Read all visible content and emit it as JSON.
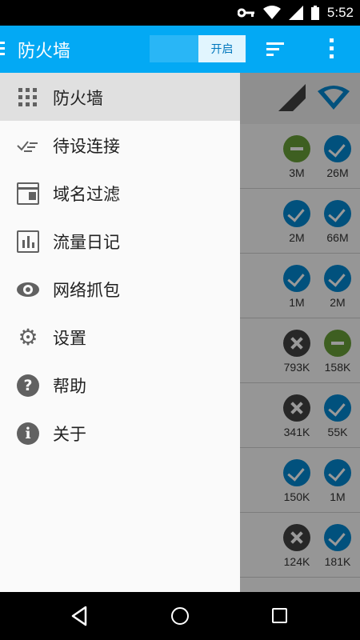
{
  "status_bar": {
    "time": "5:52",
    "icons": [
      "key-icon",
      "wifi-icon",
      "signal-icon",
      "battery-icon"
    ]
  },
  "app_bar": {
    "title": "防火墙",
    "switch_label": "开启",
    "icons": [
      "menu-icon",
      "sort-icon",
      "more-vert-icon"
    ],
    "colors": {
      "primary": "#03a9f4",
      "switch_thumb": "#e1f5fe"
    }
  },
  "drawer": {
    "items": [
      {
        "label": "防火墙",
        "icon": "apps-icon",
        "active": true
      },
      {
        "label": "待设连接",
        "icon": "pending-icon"
      },
      {
        "label": "域名过滤",
        "icon": "domain-icon"
      },
      {
        "label": "流量日记",
        "icon": "log-icon"
      },
      {
        "label": "网络抓包",
        "icon": "eye-icon"
      },
      {
        "label": "设置",
        "icon": "gear-icon"
      },
      {
        "label": "帮助",
        "icon": "help-icon"
      },
      {
        "label": "关于",
        "icon": "info-icon"
      }
    ]
  },
  "background_list": {
    "header_icons": [
      "cellular-signal-icon",
      "wifi-icon"
    ],
    "rows": [
      {
        "left": {
          "state": "minus",
          "value": "3M"
        },
        "right": {
          "state": "check",
          "value": "26M"
        }
      },
      {
        "left": {
          "state": "check",
          "value": "2M"
        },
        "right": {
          "state": "check",
          "value": "66M"
        }
      },
      {
        "left": {
          "state": "check",
          "value": "1M"
        },
        "right": {
          "state": "check",
          "value": "2M"
        }
      },
      {
        "left": {
          "state": "deny",
          "value": "793K"
        },
        "right": {
          "state": "minus",
          "value": "158K"
        }
      },
      {
        "left": {
          "state": "deny",
          "value": "341K"
        },
        "right": {
          "state": "check",
          "value": "55K"
        }
      },
      {
        "left": {
          "state": "check",
          "value": "150K"
        },
        "right": {
          "state": "check",
          "value": "1M"
        }
      },
      {
        "left": {
          "state": "deny",
          "value": "124K"
        },
        "right": {
          "state": "check",
          "value": "181K"
        }
      }
    ]
  },
  "nav_bar": {
    "icons": [
      "back-icon",
      "home-icon",
      "recents-icon"
    ]
  }
}
